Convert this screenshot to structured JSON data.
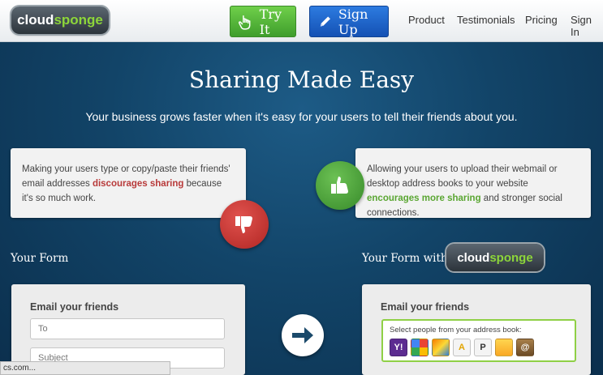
{
  "header": {
    "logo": {
      "part1": "cloud",
      "part2": "sponge"
    },
    "try_label": "Try It",
    "signup_label": "Sign Up",
    "nav": [
      "Product",
      "Testimonials",
      "Pricing",
      "Sign In"
    ]
  },
  "hero": {
    "title": "Sharing Made Easy",
    "subtitle": "Your business grows faster when it's easy for your users to tell their friends about you."
  },
  "left_card": {
    "text_a": "Making your users type or copy/paste their friends' email addresses ",
    "highlight": "discourages sharing",
    "text_b": " because it's so much work."
  },
  "right_card": {
    "text_a": "Allowing your users to upload their webmail or desktop address books to your website ",
    "highlight": "encourages more sharing",
    "text_b": " and stronger social connections."
  },
  "left_label": "Your Form",
  "right_label": "Your Form with",
  "left_form": {
    "heading": "Email your friends",
    "to_placeholder": "To",
    "subject_placeholder": "Subject"
  },
  "right_form": {
    "heading": "Email your friends",
    "address_book_prompt": "Select people from your address book:",
    "providers": [
      "yahoo-icon",
      "google-icon",
      "windows-live-icon",
      "aol-icon",
      "plaxo-icon",
      "outlook-icon",
      "address-book-icon"
    ],
    "provider_glyphs": [
      "Y!",
      "",
      "",
      "A",
      "P",
      "",
      "@"
    ]
  },
  "status_bar": "cs.com...",
  "colors": {
    "green": "#5aa632",
    "red": "#b83a3a",
    "blue": "#1451b4",
    "bg": "#0f3b5e"
  }
}
